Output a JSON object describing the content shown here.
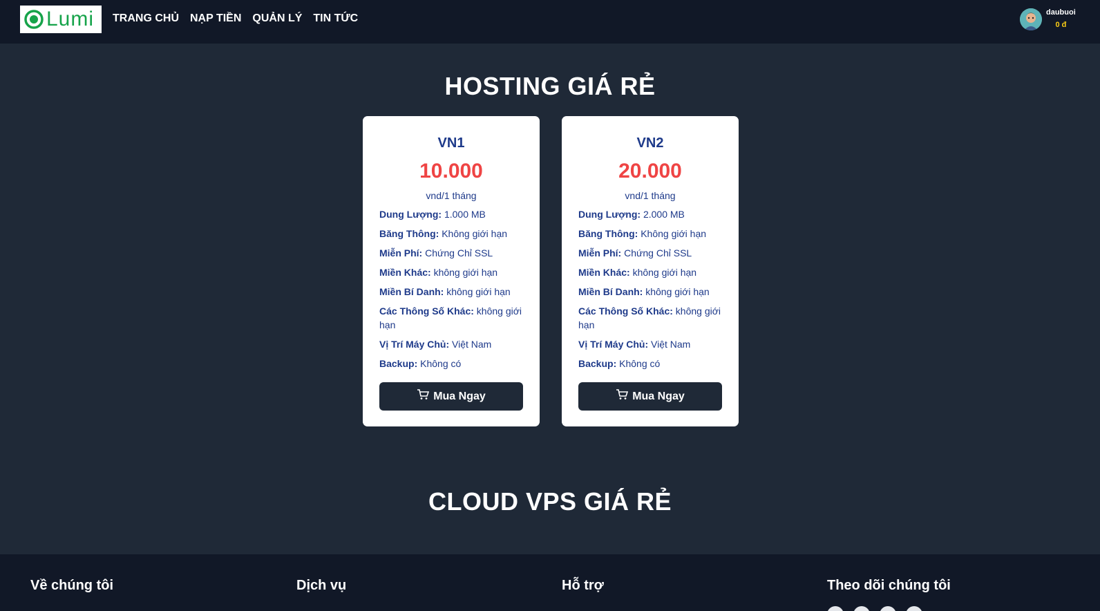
{
  "header": {
    "logo_text": "Lumi",
    "nav": [
      "TRANG CHỦ",
      "NẠP TIỀN",
      "QUẢN LÝ",
      "TIN TỨC"
    ],
    "user": {
      "name": "daubuoi",
      "balance": "0 đ"
    }
  },
  "hosting": {
    "title": "HOSTING GIÁ RẺ",
    "plans": [
      {
        "name": "VN1",
        "price": "10.000",
        "unit": "vnd/1 tháng",
        "specs": [
          {
            "key": "Dung Lượng:",
            "value": "1.000 MB"
          },
          {
            "key": "Băng Thông:",
            "value": "Không giới hạn"
          },
          {
            "key": "Miễn Phí:",
            "value": "Chứng Chỉ SSL"
          },
          {
            "key": "Miền Khác:",
            "value": "không giới hạn"
          },
          {
            "key": "Miền Bí Danh:",
            "value": "không giới hạn"
          },
          {
            "key": "Các Thông Số Khác:",
            "value": "không giới hạn"
          },
          {
            "key": "Vị Trí Máy Chủ:",
            "value": "Việt Nam"
          },
          {
            "key": "Backup:",
            "value": "Không có"
          }
        ],
        "button": "Mua Ngay"
      },
      {
        "name": "VN2",
        "price": "20.000",
        "unit": "vnd/1 tháng",
        "specs": [
          {
            "key": "Dung Lượng:",
            "value": "2.000 MB"
          },
          {
            "key": "Băng Thông:",
            "value": "Không giới hạn"
          },
          {
            "key": "Miễn Phí:",
            "value": "Chứng Chỉ SSL"
          },
          {
            "key": "Miền Khác:",
            "value": "không giới hạn"
          },
          {
            "key": "Miền Bí Danh:",
            "value": "không giới hạn"
          },
          {
            "key": "Các Thông Số Khác:",
            "value": "không giới hạn"
          },
          {
            "key": "Vị Trí Máy Chủ:",
            "value": "Việt Nam"
          },
          {
            "key": "Backup:",
            "value": "Không có"
          }
        ],
        "button": "Mua Ngay"
      }
    ]
  },
  "vps": {
    "title": "CLOUD VPS GIÁ RẺ"
  },
  "footer": {
    "columns": [
      "Về chúng tôi",
      "Dịch vụ",
      "Hỗ trợ",
      "Theo dõi chúng tôi"
    ]
  },
  "icons": {
    "logo": "lumi-logo-icon",
    "cart": "shopping-cart-icon",
    "avatar": "user-avatar"
  },
  "colors": {
    "background": "#1f2937",
    "header": "#111827",
    "price": "#ef4444",
    "plan_text": "#1e3a8a",
    "balance": "#facc15",
    "logo": "#16a34a"
  }
}
